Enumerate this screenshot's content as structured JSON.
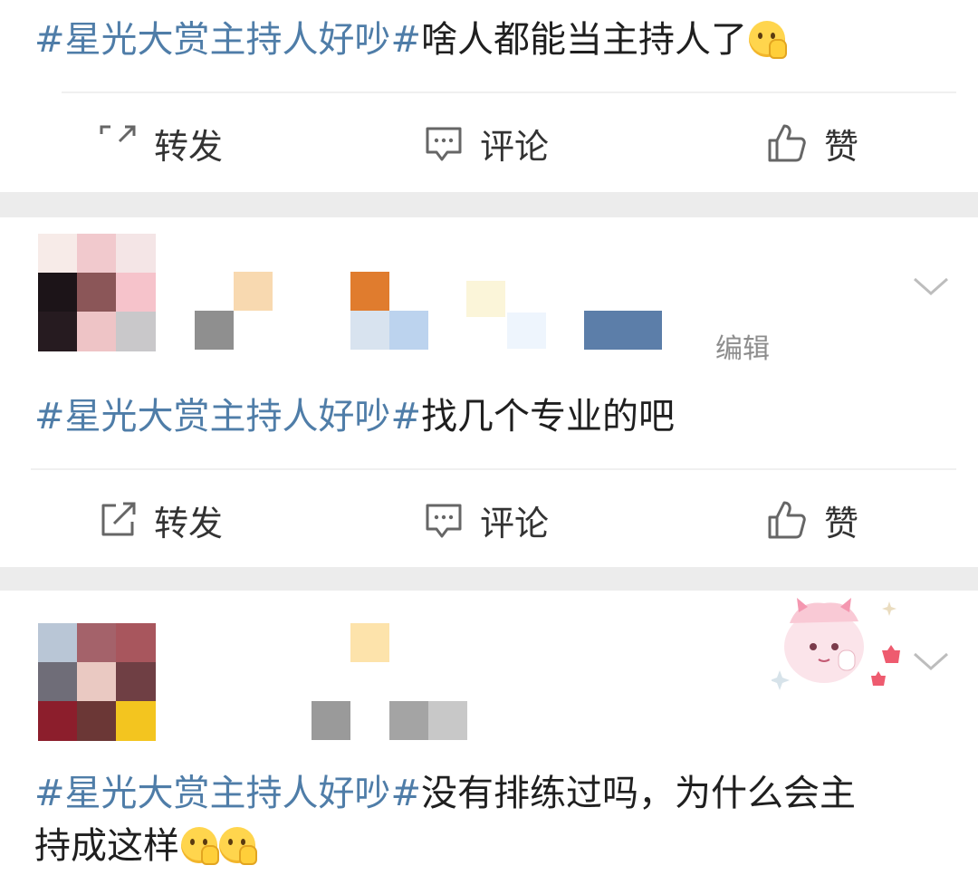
{
  "posts": [
    {
      "tag": "#星光大赏主持人好吵#",
      "text": "啥人都能当主持人了",
      "emojis": [
        "thinking-face-emoji"
      ]
    },
    {
      "tag": "#星光大赏主持人好吵#",
      "text": "找几个专业的吧",
      "emojis": []
    },
    {
      "tag": "#星光大赏主持人好吵#",
      "text_line1": "没有排练过吗，为什么会主",
      "text_line2": "持成这样",
      "emojis": [
        "thinking-face-emoji",
        "thinking-face-emoji"
      ]
    }
  ],
  "actions": {
    "repost": "转发",
    "comment": "评论",
    "like": "赞"
  },
  "post2_meta": {
    "edited": "编辑"
  },
  "icons": {
    "repost": "repost-icon",
    "comment": "comment-icon",
    "like": "thumbs-up-icon",
    "more": "chevron-down-icon"
  },
  "colors": {
    "tag": "#4f7da8",
    "text": "#1f1f1f",
    "separator": "#ececec"
  }
}
